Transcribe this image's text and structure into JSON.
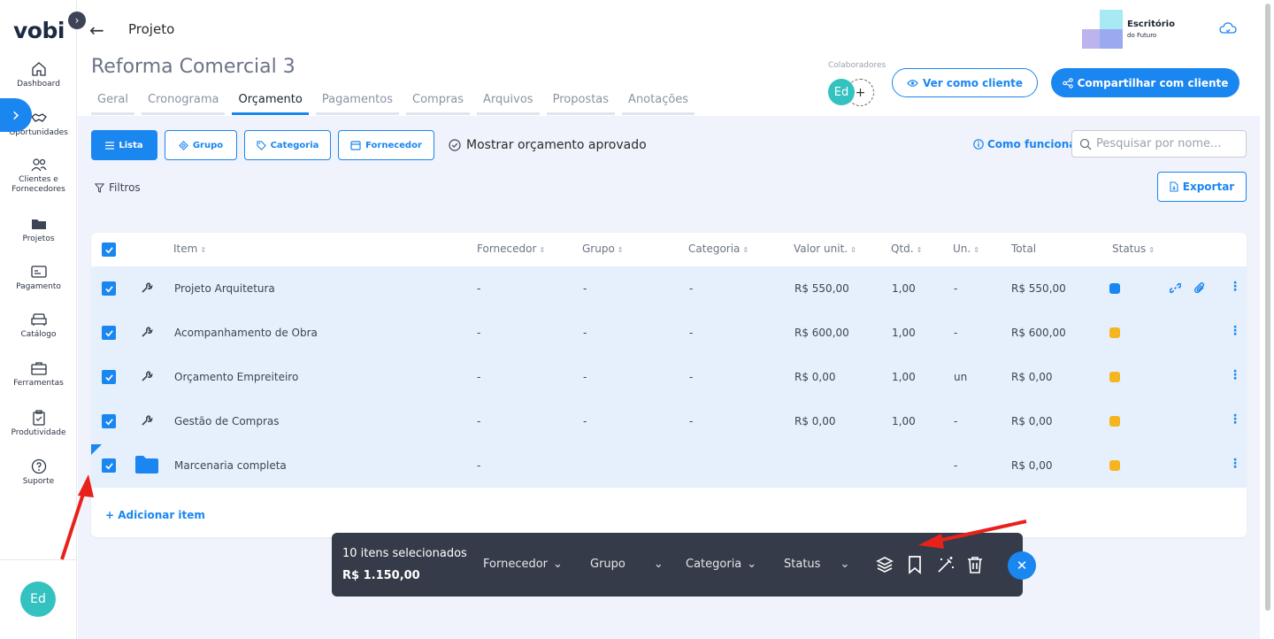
{
  "sidebar": {
    "logo": "vobi",
    "items": [
      {
        "label": "Dashboard",
        "icon": "home-icon"
      },
      {
        "label": "Oportunidades",
        "icon": "handshake-icon"
      },
      {
        "label": "Clientes e Fornecedores",
        "icon": "people-icon"
      },
      {
        "label": "Projetos",
        "icon": "folder-icon"
      },
      {
        "label": "Pagamento",
        "icon": "payment-icon"
      },
      {
        "label": "Catálogo",
        "icon": "sofa-icon"
      },
      {
        "label": "Ferramentas",
        "icon": "toolbox-icon"
      },
      {
        "label": "Produtividade",
        "icon": "clipboard-icon"
      },
      {
        "label": "Suporte",
        "icon": "help-icon"
      }
    ],
    "user_initials": "Ed"
  },
  "header": {
    "back_label": "Projeto",
    "project_title": "Reforma Comercial 3",
    "tabs": [
      "Geral",
      "Cronograma",
      "Orçamento",
      "Pagamentos",
      "Compras",
      "Arquivos",
      "Propostas",
      "Anotações"
    ],
    "active_tab": "Orçamento",
    "company_name": "Escritório",
    "company_sub": "do Futuro",
    "collaborators_label": "Colaboradores",
    "collaborator_initials": "Ed",
    "view_as_client": "Ver como cliente",
    "share_with_client": "Compartilhar com cliente"
  },
  "toolbar": {
    "views": [
      "Lista",
      "Grupo",
      "Categoria",
      "Fornecedor"
    ],
    "active_view": "Lista",
    "show_approved": "Mostrar orçamento aprovado",
    "how_it_works": "Como funciona",
    "search_placeholder": "Pesquisar por nome...",
    "filters": "Filtros",
    "export": "Exportar"
  },
  "table": {
    "columns": [
      "Item",
      "Fornecedor",
      "Grupo",
      "Categoria",
      "Valor unit.",
      "Qtd.",
      "Un.",
      "Total",
      "Status"
    ],
    "rows": [
      {
        "item": "Projeto Arquitetura",
        "fornecedor": "-",
        "grupo": "-",
        "categoria": "-",
        "valor": "R$ 550,00",
        "qtd": "1,00",
        "un": "-",
        "total": "R$ 550,00",
        "status_color": "#1a86f0",
        "type": "service"
      },
      {
        "item": "Acompanhamento de Obra",
        "fornecedor": "-",
        "grupo": "-",
        "categoria": "-",
        "valor": "R$ 600,00",
        "qtd": "1,00",
        "un": "-",
        "total": "R$ 600,00",
        "status_color": "#f6b51e",
        "type": "service"
      },
      {
        "item": "Orçamento Empreiteiro",
        "fornecedor": "-",
        "grupo": "-",
        "categoria": "-",
        "valor": "R$ 0,00",
        "qtd": "1,00",
        "un": "un",
        "total": "R$ 0,00",
        "status_color": "#f6b51e",
        "type": "service"
      },
      {
        "item": "Gestão de Compras",
        "fornecedor": "-",
        "grupo": "-",
        "categoria": "-",
        "valor": "R$ 0,00",
        "qtd": "1,00",
        "un": "-",
        "total": "R$ 0,00",
        "status_color": "#f6b51e",
        "type": "service"
      },
      {
        "item": "Marcenaria completa",
        "fornecedor": "-",
        "grupo": "",
        "categoria": "",
        "valor": "",
        "qtd": "",
        "un": "-",
        "total": "R$ 0,00",
        "status_color": "#f6b51e",
        "type": "folder"
      }
    ],
    "add_item": "+ Adicionar item"
  },
  "action_bar": {
    "selected_count": "10 itens selecionados",
    "selected_total": "R$ 1.150,00",
    "dropdowns": [
      "Fornecedor",
      "Grupo",
      "Categoria",
      "Status"
    ]
  },
  "colors": {
    "primary": "#1a86f0",
    "status_blue": "#1a86f0",
    "status_yellow": "#f6b51e",
    "annotation_red": "#e8221b"
  }
}
